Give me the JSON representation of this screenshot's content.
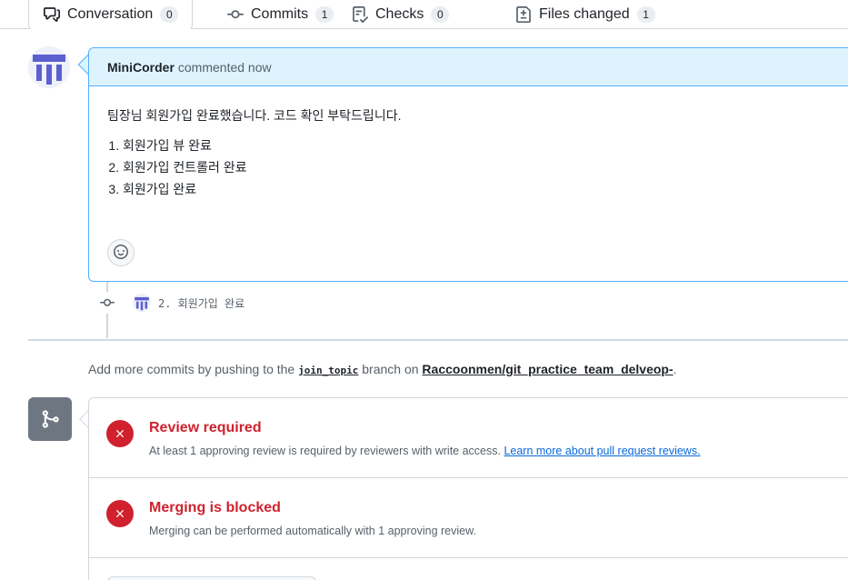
{
  "tabs": [
    {
      "label": "Conversation",
      "count": "0"
    },
    {
      "label": "Commits",
      "count": "1"
    },
    {
      "label": "Checks",
      "count": "0"
    },
    {
      "label": "Files changed",
      "count": "1"
    }
  ],
  "comment": {
    "author": "MiniCorder",
    "action": "commented now",
    "body": "팀장님 회원가입 완료했습니다. 코드 확인 부탁드립니다.",
    "items": [
      "회원가입 뷰 완료",
      "회원가입 컨트롤러 완료",
      "회원가입 완료"
    ]
  },
  "commit": {
    "message": "2. 회원가입 완료"
  },
  "hint": {
    "prefix": "Add more commits by pushing to the",
    "branch": "join_topic",
    "middle": "branch on",
    "repo": "Raccoonmen/git_practice_team_delveop-",
    "suffix": "."
  },
  "merge": {
    "review": {
      "title": "Review required",
      "desc": "At least 1 approving review is required by reviewers with write access.",
      "link": "Learn more about pull request reviews."
    },
    "blocked": {
      "title": "Merging is blocked",
      "desc": "Merging can be performed automatically with 1 approving review."
    }
  },
  "colors": {
    "accent": "#0969da",
    "danger": "#cf222e",
    "header_bg": "#ddf4ff",
    "avatar": "#5c5fcf"
  },
  "icons": [
    "comment-discussion-icon",
    "git-commit-icon",
    "checklist-icon",
    "file-diff-icon",
    "smiley-icon",
    "git-merge-icon",
    "x-icon"
  ]
}
